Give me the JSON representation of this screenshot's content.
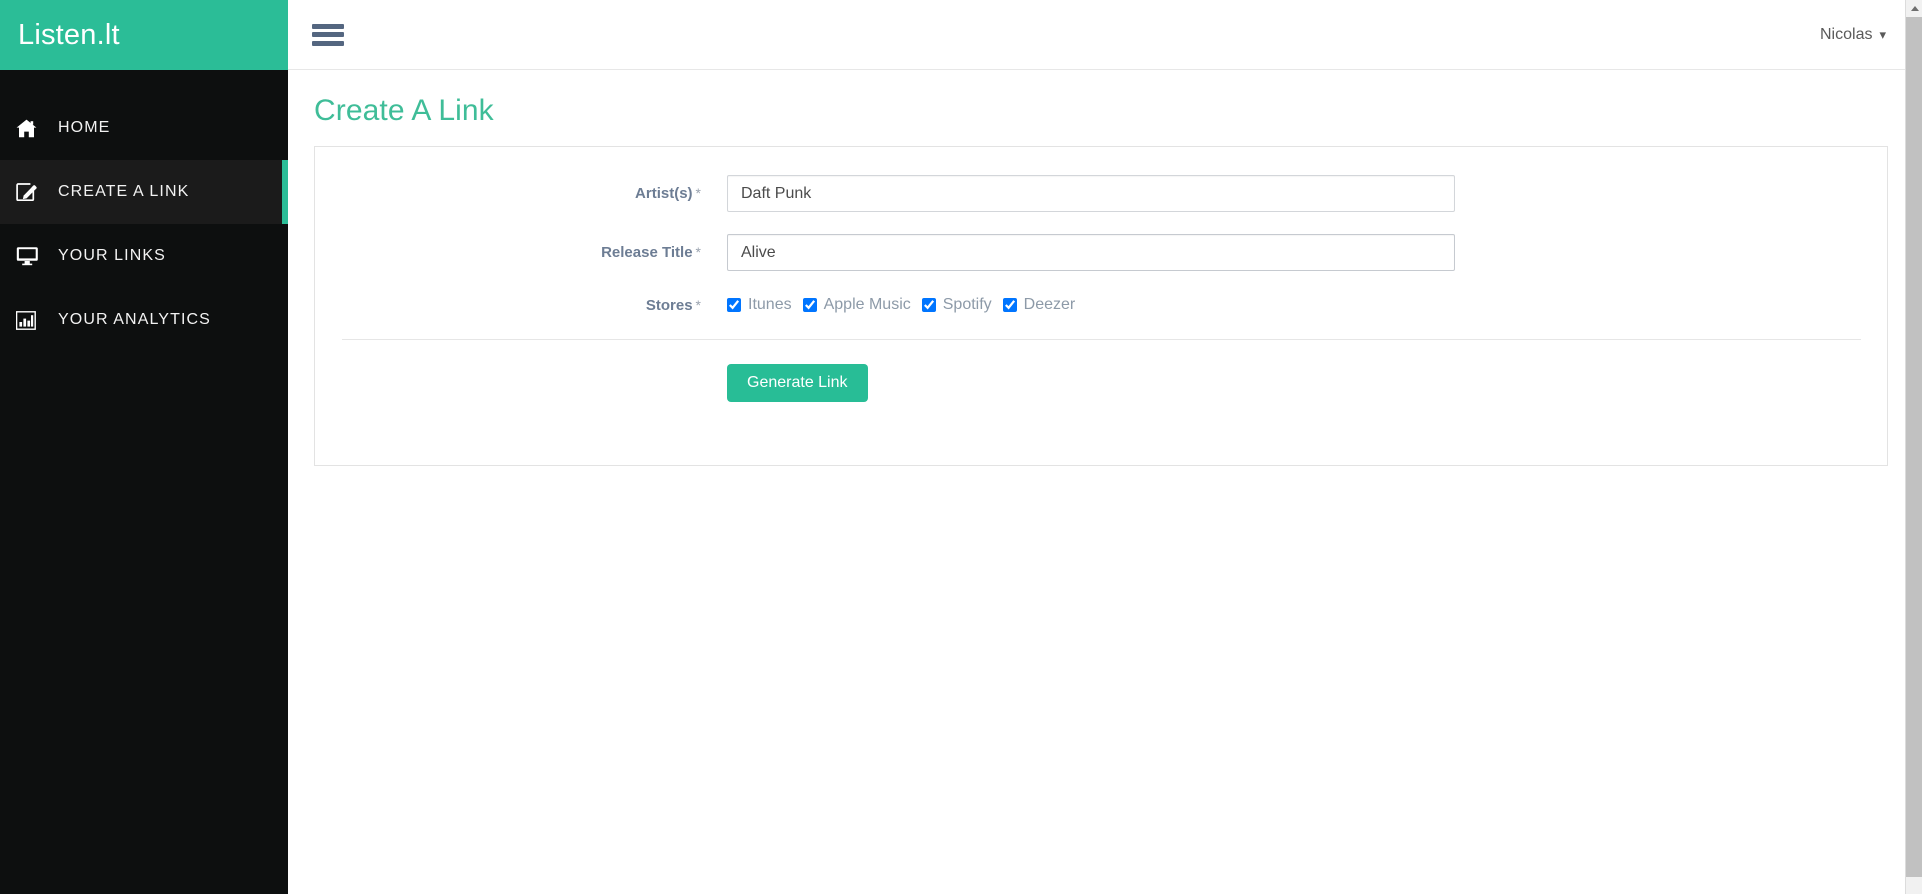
{
  "brand": {
    "name": "Listen.lt"
  },
  "sidebar": {
    "items": [
      {
        "label": "HOME",
        "icon": "home-icon",
        "active": false
      },
      {
        "label": "CREATE A LINK",
        "icon": "pencil-square-icon",
        "active": true
      },
      {
        "label": "YOUR LINKS",
        "icon": "desktop-icon",
        "active": false
      },
      {
        "label": "YOUR ANALYTICS",
        "icon": "bar-chart-icon",
        "active": false
      }
    ]
  },
  "topbar": {
    "menu_toggle": "hamburger-icon",
    "user": "Nicolas",
    "caret": "⌄"
  },
  "page": {
    "title": "Create A Link"
  },
  "form": {
    "fields": [
      {
        "label": "Artist(s)",
        "required_mark": "*",
        "value": "Daft Punk",
        "placeholder": "Artist(s)"
      },
      {
        "label": "Release Title",
        "required_mark": "*",
        "value": "Alive",
        "placeholder": "Release Title"
      }
    ],
    "stores": {
      "label": "Stores",
      "required_mark": "*",
      "options": [
        {
          "label": "Itunes",
          "checked": true
        },
        {
          "label": "Apple Music",
          "checked": true
        },
        {
          "label": "Spotify",
          "checked": true
        },
        {
          "label": "Deezer",
          "checked": true
        }
      ]
    },
    "submit_label": "Generate Link"
  },
  "colors": {
    "accent": "#2bbd97",
    "sidebar_bg": "#0d0f0f",
    "sidebar_active_bg": "#1b1b1b",
    "title": "#3fbd98",
    "label": "#6d7d94",
    "store_label": "#8d9aa8",
    "hamburger": "#546680"
  }
}
